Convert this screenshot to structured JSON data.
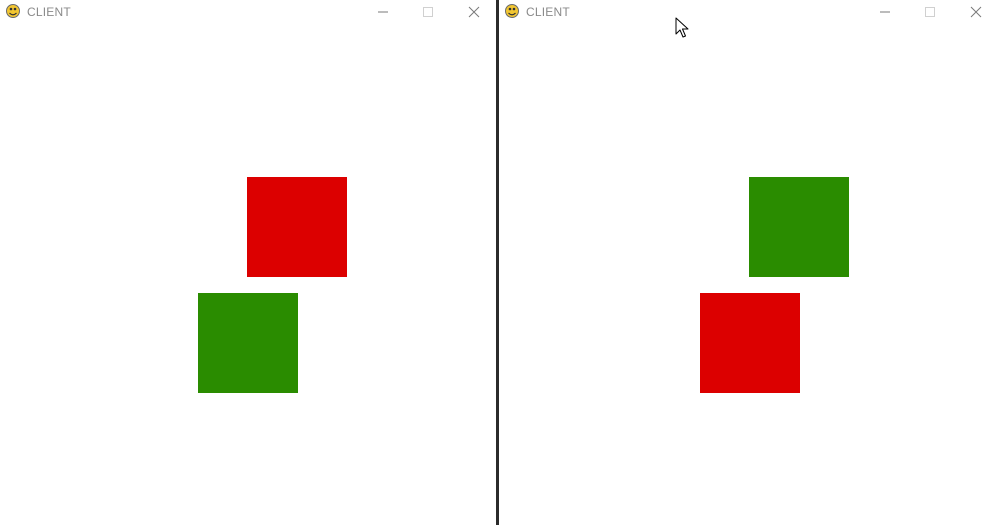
{
  "windows": [
    {
      "title": "CLIENT",
      "squares": [
        {
          "name": "red-player-square",
          "color": "#dc0000"
        },
        {
          "name": "green-player-square",
          "color": "#2a8c00"
        }
      ]
    },
    {
      "title": "CLIENT",
      "squares": [
        {
          "name": "green-player-square",
          "color": "#2a8c00"
        },
        {
          "name": "red-player-square",
          "color": "#dc0000"
        }
      ]
    }
  ],
  "icons": {
    "app": "pygame-snake-icon",
    "minimize": "minimize-icon",
    "maximize": "maximize-icon",
    "close": "close-icon",
    "cursor": "mouse-pointer-icon"
  }
}
